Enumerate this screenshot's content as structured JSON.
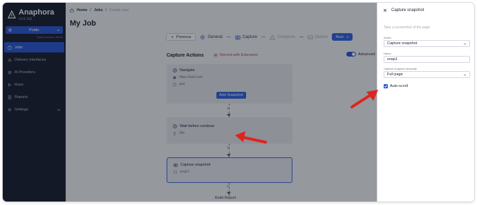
{
  "app": {
    "name": "Anaphora",
    "version": "v0.8.168"
  },
  "sidebar": {
    "workspace": {
      "label": "Public",
      "subtext": "Space access: admin"
    },
    "items": [
      {
        "label": "Jobs",
        "icon": "jobs-icon",
        "active": true
      },
      {
        "label": "Delivery Interfaces",
        "icon": "delivery-icon"
      },
      {
        "label": "AI Providers",
        "icon": "ai-icon"
      },
      {
        "label": "Runs",
        "icon": "runs-icon"
      },
      {
        "label": "Reports",
        "icon": "reports-icon"
      },
      {
        "label": "Settings",
        "icon": "settings-icon"
      }
    ]
  },
  "breadcrumb": {
    "home": "Home",
    "jobs": "Jobs",
    "current": "Create new"
  },
  "page_title": "My Job",
  "stepper": {
    "previous": "Previous",
    "next": "Next",
    "steps": [
      {
        "label": "General",
        "active": true
      },
      {
        "label": "Capture",
        "active": true
      },
      {
        "label": "Compose",
        "active": false
      },
      {
        "label": "Deliver",
        "active": false
      }
    ]
  },
  "capture": {
    "title": "Capture Actions",
    "record_extension": "Record with Extension",
    "advanced_label": "Advanced"
  },
  "cards": {
    "navigate": {
      "title": "Navigate",
      "url": "https://asd.com",
      "tag": "asd",
      "add_button": "Add Snapshot"
    },
    "wait": {
      "title": "Wait before continue",
      "duration": "30s"
    },
    "snapshot": {
      "title": "Capture snapshot",
      "name": "snap1"
    }
  },
  "build_report": "Build Report",
  "panel": {
    "title": "Capture snapshot",
    "subtitle": "Take a screenshot of the page",
    "action_label": "Action",
    "action_value": "Capture snapshot",
    "name_label": "Name",
    "name_value": "snap1",
    "template_label": "Capture snapshot template",
    "template_value": "Full page",
    "autoscroll_label": "Auto-scroll"
  },
  "colors": {
    "accent": "#2755d6",
    "sidebar": "#141b2b",
    "arrow": "#e0231d",
    "record": "#c0337c"
  }
}
